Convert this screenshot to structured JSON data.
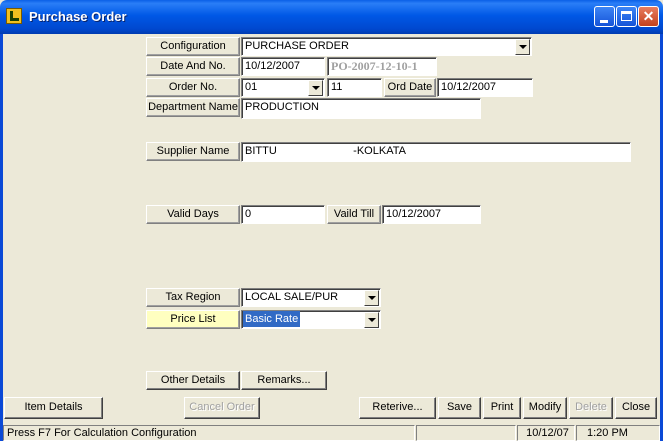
{
  "window": {
    "title": "Purchase Order"
  },
  "form": {
    "configuration": {
      "label": "Configuration",
      "value": "PURCHASE ORDER"
    },
    "date_and_no": {
      "label": "Date And No.",
      "date": "10/12/2007",
      "po_number": "PO-2007-12-10-1"
    },
    "order_no": {
      "label": "Order No.",
      "value": "01",
      "number": "11",
      "ord_date_label": "Ord Date",
      "ord_date": "10/12/2007"
    },
    "department_name": {
      "label": "Department Name",
      "value": "PRODUCTION"
    },
    "supplier_name": {
      "label": "Supplier Name",
      "value": "BITTU                         -KOLKATA"
    },
    "valid_days": {
      "label": "Valid Days",
      "value": "0",
      "valid_till_label": "Vaild Till",
      "valid_till": "10/12/2007"
    },
    "tax_region": {
      "label": "Tax Region",
      "value": "LOCAL SALE/PUR"
    },
    "price_list": {
      "label": "Price List",
      "value": "Basic Rate"
    },
    "other_details_label": "Other Details",
    "remarks_label": "Remarks..."
  },
  "buttons": {
    "item_details": "Item Details",
    "cancel_order": "Cancel Order",
    "retrieve": "Reterive...",
    "save": "Save",
    "print": "Print",
    "modify": "Modify",
    "delete": "Delete",
    "close": "Close"
  },
  "status": {
    "hint": "Press F7 For Calculation Configuration",
    "date": "10/12/07",
    "time": "1:20 PM"
  },
  "colors": {
    "titlebar": "#0058e6",
    "highlight_label": "#ffffc0",
    "selection": "#316ac5"
  }
}
